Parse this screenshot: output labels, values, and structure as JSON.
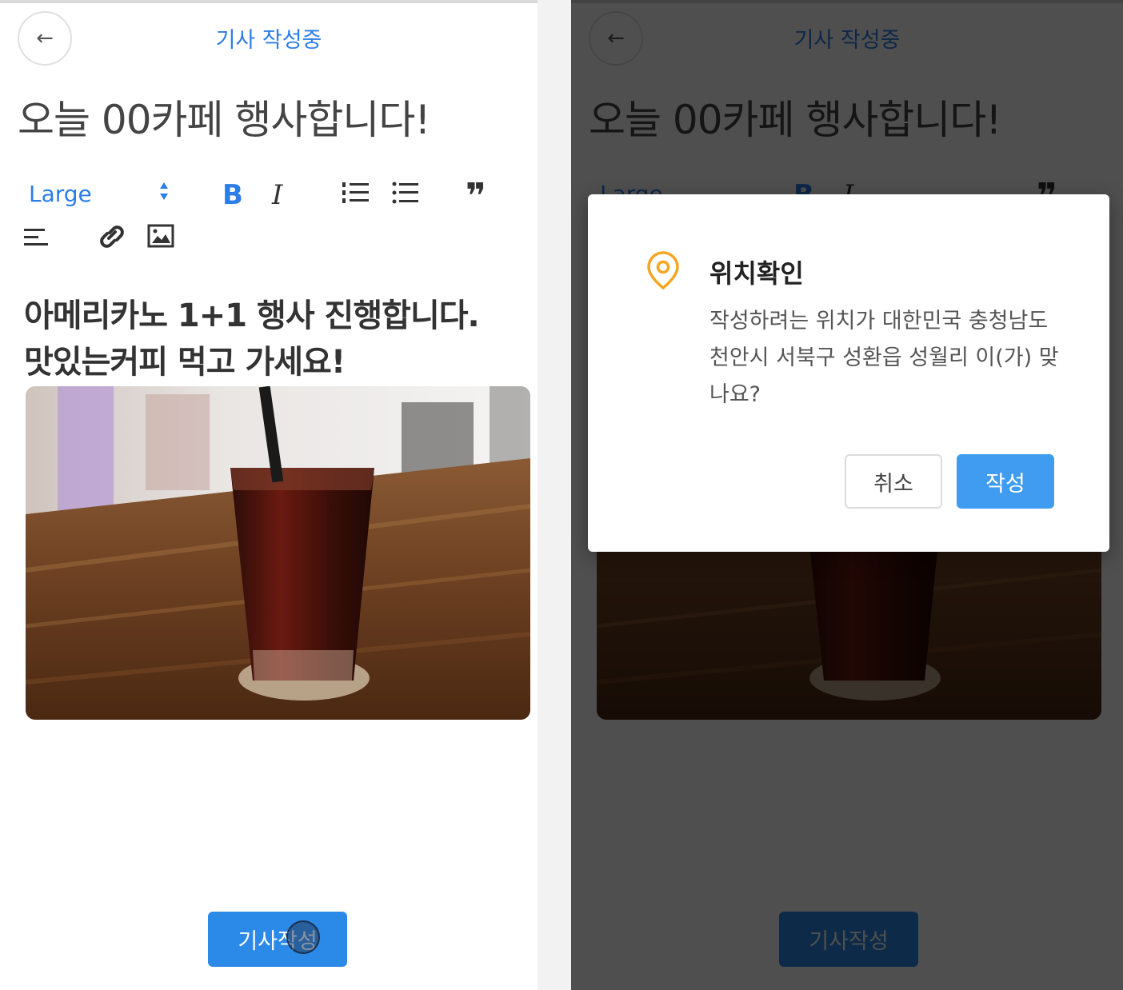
{
  "header": {
    "title": "기사 작성중",
    "back_icon": "←"
  },
  "article": {
    "title": "오늘 00카페 행사합니다!",
    "body_line1": "아메리카노 1+1 행사 진행합니다.",
    "body_line2": "맛있는커피 먹고 가세요!"
  },
  "toolbar": {
    "size_label": "Large",
    "size_arrows": "◆",
    "bold": "B",
    "italic": "I",
    "quote": "❞"
  },
  "submit_label": "기사작성",
  "dialog": {
    "title": "위치확인",
    "message": "작성하려는 위치가 대한민국 충청남도 천안시 서북구 성환읍 성월리 이(가) 맞나요?",
    "cancel_label": "취소",
    "confirm_label": "작성"
  },
  "colors": {
    "accent": "#2b7de9",
    "button": "#2b8ae8",
    "confirm": "#3f9cf0",
    "pin": "#f5a623"
  }
}
